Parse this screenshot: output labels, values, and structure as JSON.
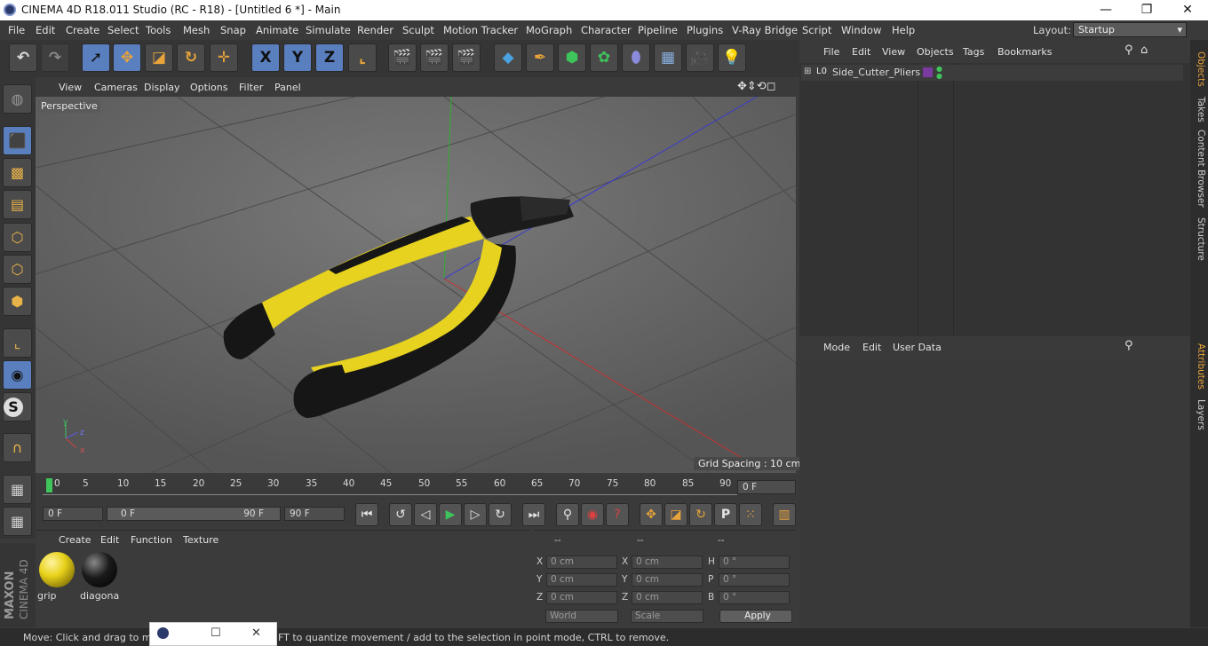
{
  "app": {
    "title": "CINEMA 4D R18.011 Studio (RC - R18) - [Untitled 6 *] - Main",
    "window_controls": {
      "minimize": "—",
      "maximize": "❐",
      "close": "✕"
    }
  },
  "menubar": {
    "items": [
      "File",
      "Edit",
      "Create",
      "Select",
      "Tools",
      "Mesh",
      "Snap",
      "Animate",
      "Simulate",
      "Render",
      "Sculpt",
      "Motion Tracker",
      "MoGraph",
      "Character",
      "Pipeline",
      "Plugins",
      "V-Ray Bridge",
      "Script",
      "Window",
      "Help"
    ],
    "layout_label": "Layout:",
    "layout_value": "Startup"
  },
  "toolbar": {
    "axis_x": "X",
    "axis_y": "Y",
    "axis_z": "Z"
  },
  "viewport": {
    "menu": [
      "View",
      "Cameras",
      "Display",
      "Options",
      "Filter",
      "Panel"
    ],
    "camera_label": "Perspective",
    "grid_spacing": "Grid Spacing : 10 cm",
    "axis_gizmo": {
      "y": "y",
      "z": "z",
      "x": "x"
    }
  },
  "timeline": {
    "ticks": [
      "0",
      "5",
      "10",
      "15",
      "20",
      "25",
      "30",
      "35",
      "40",
      "45",
      "50",
      "55",
      "60",
      "65",
      "70",
      "75",
      "80",
      "85",
      "90"
    ],
    "current_frame": "0 F"
  },
  "transport": {
    "start_field": "0 F",
    "range_start": "0 F",
    "range_end": "90 F",
    "end_field": "90 F",
    "keyframe_p": "P"
  },
  "materials": {
    "menu": [
      "Create",
      "Edit",
      "Function",
      "Texture"
    ],
    "items": [
      {
        "label": "grip",
        "color": "#e8d21a"
      },
      {
        "label": "diagona",
        "color": "#1a1a1a"
      }
    ]
  },
  "coordinates": {
    "headers": [
      "--",
      "--",
      "--"
    ],
    "rows": [
      {
        "a": "X",
        "av": "0 cm",
        "b": "X",
        "bv": "0 cm",
        "c": "H",
        "cv": "0 °"
      },
      {
        "a": "Y",
        "av": "0 cm",
        "b": "Y",
        "bv": "0 cm",
        "c": "P",
        "cv": "0 °"
      },
      {
        "a": "Z",
        "av": "0 cm",
        "b": "Z",
        "bv": "0 cm",
        "c": "B",
        "cv": "0 °"
      }
    ],
    "space_select": "World",
    "scale_select": "Scale",
    "apply": "Apply"
  },
  "objects_panel": {
    "menu": [
      "File",
      "Edit",
      "View",
      "Objects",
      "Tags",
      "Bookmarks"
    ],
    "object_name": "Side_Cutter_Pliers",
    "object_icon": "L0"
  },
  "attributes_panel": {
    "menu": [
      "Mode",
      "Edit",
      "User Data"
    ]
  },
  "right_tabs": [
    "Objects",
    "Takes",
    "Content Browser",
    "Structure",
    "Attributes",
    "Layers"
  ],
  "status": {
    "text": "Move: Click and drag to mo",
    "text_tail": "FT to quantize movement / add to the selection in point mode, CTRL to remove."
  },
  "brand": {
    "maxon": "MAXON",
    "cinema": "CINEMA 4D"
  },
  "colors": {
    "accent": "#5a7fbf",
    "pliers_yellow": "#e6d21f",
    "pliers_black": "#161616"
  }
}
